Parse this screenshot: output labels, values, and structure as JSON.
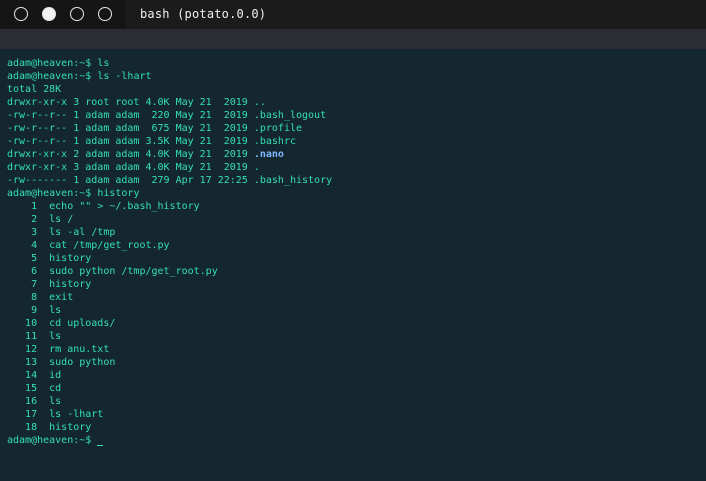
{
  "window": {
    "title": "bash (potato.0.0)",
    "controls": [
      "circle-outline",
      "circle-filled",
      "circle-outline",
      "circle-outline"
    ]
  },
  "terminal": {
    "lines": [
      {
        "prompt": "adam@heaven:~$",
        "text": " ls"
      },
      {
        "prompt": "adam@heaven:~$",
        "text": " ls -lhart"
      },
      {
        "text": "total 28K"
      },
      {
        "text": "drwxr-xr-x 3 root root 4.0K May 21  2019 .."
      },
      {
        "text": "-rw-r--r-- 1 adam adam  220 May 21  2019 .bash_logout"
      },
      {
        "text": "-rw-r--r-- 1 adam adam  675 May 21  2019 .profile"
      },
      {
        "text": "-rw-r--r-- 1 adam adam 3.5K May 21  2019 .bashrc"
      },
      {
        "text": "drwxr-xr-x 2 adam adam 4.0K May 21  2019 ",
        "highlight": ".nano"
      },
      {
        "text": "drwxr-xr-x 3 adam adam 4.0K May 21  2019 ."
      },
      {
        "text": "-rw------- 1 adam adam  279 Apr 17 22:25 .bash_history"
      },
      {
        "prompt": "adam@heaven:~$",
        "text": " history"
      },
      {
        "text": "    1  echo \"\" > ~/.bash_history"
      },
      {
        "text": "    2  ls /"
      },
      {
        "text": "    3  ls -al /tmp"
      },
      {
        "text": "    4  cat /tmp/get_root.py"
      },
      {
        "text": "    5  history"
      },
      {
        "text": "    6  sudo python /tmp/get_root.py"
      },
      {
        "text": "    7  history"
      },
      {
        "text": "    8  exit"
      },
      {
        "text": "    9  ls"
      },
      {
        "text": "   10  cd uploads/"
      },
      {
        "text": "   11  ls"
      },
      {
        "text": "   12  rm anu.txt"
      },
      {
        "text": "   13  sudo python"
      },
      {
        "text": "   14  id"
      },
      {
        "text": "   15  cd"
      },
      {
        "text": "   16  ls"
      },
      {
        "text": "   17  ls -lhart"
      },
      {
        "text": "   18  history"
      },
      {
        "prompt": "adam@heaven:~$",
        "text": " ",
        "cursor": true
      }
    ]
  },
  "colors": {
    "background": "#14262f",
    "text": "#33e0b5",
    "directory_highlight": "#7fb8ff"
  }
}
